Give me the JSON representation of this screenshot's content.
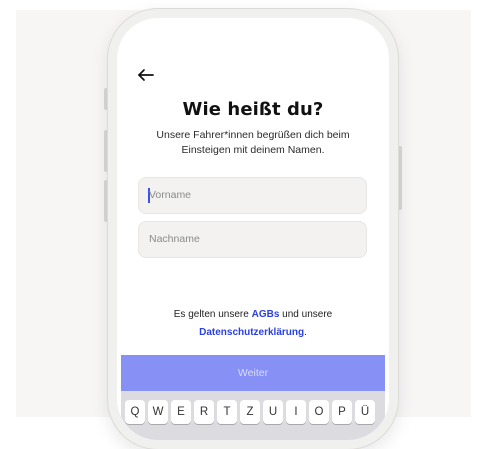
{
  "screen": {
    "title": "Wie heißt du?",
    "subtitle": "Unsere Fahrer*innen begrüßen dich beim Einsteigen mit deinem Namen."
  },
  "form": {
    "first_name": {
      "value": "",
      "placeholder": "Vorname"
    },
    "last_name": {
      "value": "",
      "placeholder": "Nachname"
    }
  },
  "terms": {
    "prefix": "Es gelten unsere ",
    "agb_link": "AGBs",
    "middle": " und unsere",
    "privacy_link": "Datenschutzerklärung",
    "suffix": "."
  },
  "submit": {
    "label": "Weiter"
  },
  "keyboard": {
    "keys": [
      "Q",
      "W",
      "E",
      "R",
      "T",
      "Z",
      "U",
      "I",
      "O",
      "P",
      "Ü"
    ]
  },
  "icons": {
    "back": "arrow-left-icon"
  },
  "colors": {
    "accent": "#2b40e0",
    "submit_disabled": "#8791f5",
    "field_background": "#f3f2f0",
    "page_background": "#f7f6f5"
  }
}
